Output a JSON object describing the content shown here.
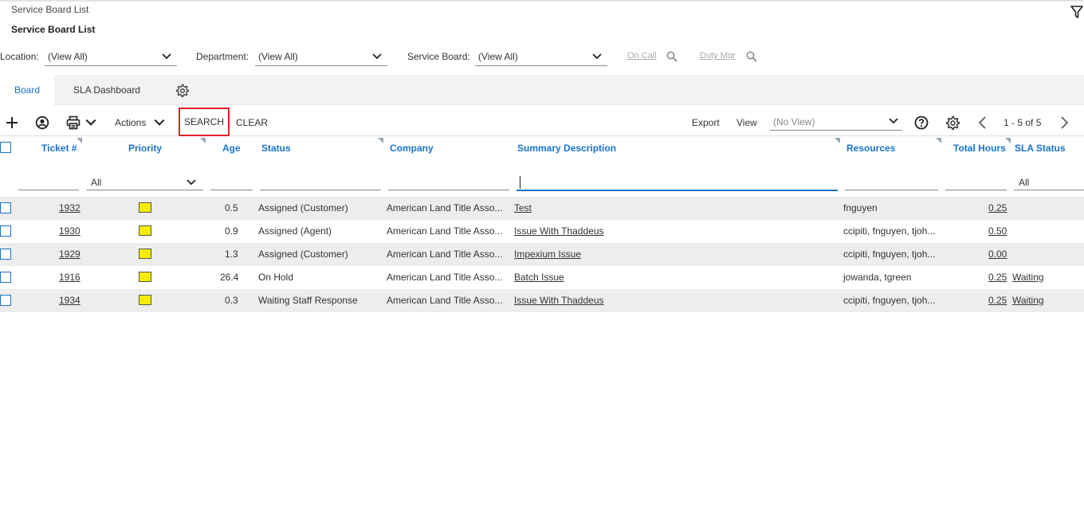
{
  "header": {
    "breadcrumb": "Service Board List",
    "title": "Service Board List"
  },
  "filters": {
    "location_label": "Location:",
    "location_value": "(View All)",
    "department_label": "Department:",
    "department_value": "(View All)",
    "service_board_label": "Service Board:",
    "service_board_value": "(View All)",
    "on_call": "On Call",
    "duty_mgr": "Duty Mgr"
  },
  "tabs": [
    {
      "label": "Board",
      "active": true
    },
    {
      "label": "SLA Dashboard",
      "active": false
    }
  ],
  "toolbar": {
    "actions": "Actions",
    "search": "SEARCH",
    "clear": "CLEAR",
    "export": "Export",
    "view_label": "View",
    "view_value": "(No View)",
    "pagination": "1 - 5 of 5"
  },
  "table": {
    "columns": [
      "Ticket #",
      "Priority",
      "Age",
      "Status",
      "Company",
      "Summary Description",
      "Resources",
      "Total Hours",
      "SLA Status"
    ],
    "filter_priority": "All",
    "filter_sla": "All",
    "rows": [
      {
        "ticket": "1932",
        "age": "0.5",
        "status": "Assigned (Customer)",
        "company": "American Land Title Asso...",
        "summary": "Test",
        "resources": "fnguyen",
        "hours": "0.25",
        "sla": ""
      },
      {
        "ticket": "1930",
        "age": "0.9",
        "status": "Assigned (Agent)",
        "company": "American Land Title Asso...",
        "summary": "Issue With Thaddeus",
        "resources": "ccipiti, fnguyen, tjoh...",
        "hours": "0.50",
        "sla": ""
      },
      {
        "ticket": "1929",
        "age": "1.3",
        "status": "Assigned (Customer)",
        "company": "American Land Title Asso...",
        "summary": "Impexium Issue",
        "resources": "ccipiti, fnguyen, tjoh...",
        "hours": "0.00",
        "sla": ""
      },
      {
        "ticket": "1916",
        "age": "26.4",
        "status": "On Hold",
        "company": "American Land Title Asso...",
        "summary": "Batch Issue",
        "resources": "jowanda, tgreen",
        "hours": "0.25",
        "sla": "Waiting"
      },
      {
        "ticket": "1934",
        "age": "0.3",
        "status": "Waiting Staff Response",
        "company": "American Land Title Asso...",
        "summary": "Issue With Thaddeus",
        "resources": "ccipiti, fnguyen, tjoh...",
        "hours": "0.25",
        "sla": "Waiting"
      }
    ]
  },
  "colors": {
    "accent": "#1a73c9",
    "priority_swatch": "#f5ec00",
    "highlight_border": "#e0202a",
    "alt_row": "#ededed"
  }
}
